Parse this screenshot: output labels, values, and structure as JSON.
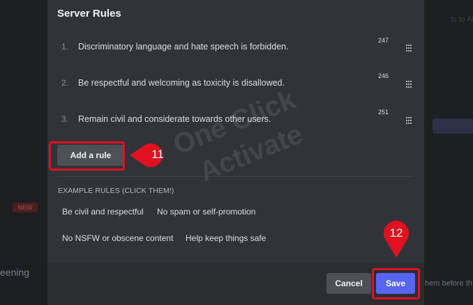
{
  "background": {
    "left_badge": "NEW",
    "left_text": "eening",
    "right_text_top": "ts to Al",
    "right_text_bottom": "hem before th"
  },
  "modal": {
    "title": "Server Rules",
    "rules": [
      {
        "number": "1.",
        "text": "Discriminatory language and hate speech is forbidden.",
        "char_count": "247"
      },
      {
        "number": "2.",
        "text": "Be respectful and welcoming as toxicity is disallowed.",
        "char_count": "246"
      },
      {
        "number": "3.",
        "text": "Remain civil and considerate towards other users.",
        "char_count": "251"
      }
    ],
    "add_rule_label": "Add a rule",
    "examples_heading": "EXAMPLE RULES (CLICK THEM!)",
    "example_rules": [
      "Be civil and respectful",
      "No spam or self-promotion",
      "No NSFW or obscene content",
      "Help keep things safe"
    ],
    "cancel_label": "Cancel",
    "save_label": "Save"
  },
  "annotations": {
    "callout_add_rule": "11",
    "callout_save": "12",
    "highlight_color": "#e1111f",
    "watermark_text": [
      "One Click",
      "Activate"
    ]
  },
  "colors": {
    "modal_bg": "#313338",
    "footer_bg": "#2b2d31",
    "primary": "#5865f2",
    "secondary_button": "#4e5058"
  },
  "icons": {
    "drag_handle": "drag-handle-icon",
    "callout_pin": "map-pin-marker"
  }
}
